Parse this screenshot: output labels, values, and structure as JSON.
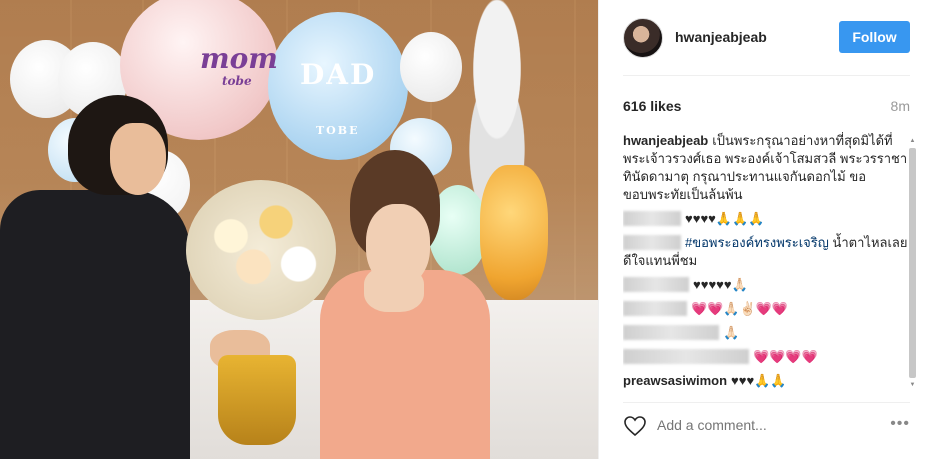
{
  "photo": {
    "mom_text": "mom",
    "mom_sub": "tobe",
    "dad_text": "DAD",
    "dad_sub": "TOBE"
  },
  "post": {
    "username": "hwanjeabjeab",
    "follow_label": "Follow",
    "likes": "616 likes",
    "time": "8m"
  },
  "comments": [
    {
      "user": "hwanjeabjeab",
      "text": "เป็นพระกรุณาอย่างหาที่สุดมิได้ที่ พระเจ้าวรวงศ์เธอ พระองค์เจ้าโสมสวลี พระวรราชาทินัดดามาตุ กรุณาประทานแจกันดอกไม้ ขอขอบพระทัยเป็นล้นพ้น"
    },
    {
      "text": "♥♥♥♥🙏🙏🙏"
    },
    {
      "tag": "#ขอพระองค์ทรงพระเจริญ",
      "text": " น้ำตาไหลเลย ดีใจแทนพี่ชม"
    },
    {
      "text": "♥♥♥♥♥🙏🏻"
    },
    {
      "text": "💗💗🙏🏻✌🏻💗💗"
    },
    {
      "text": "🙏🏻"
    },
    {
      "text": "💗💗💗💗"
    },
    {
      "user": "preawsasiwimon",
      "text": "♥♥♥🙏🙏"
    }
  ],
  "footer": {
    "placeholder": "Add a comment...",
    "more": "•••"
  },
  "colors": {
    "follow": "#3897f0",
    "tag": "#003569"
  },
  "icons": [
    "heart-icon",
    "more-options-icon"
  ]
}
